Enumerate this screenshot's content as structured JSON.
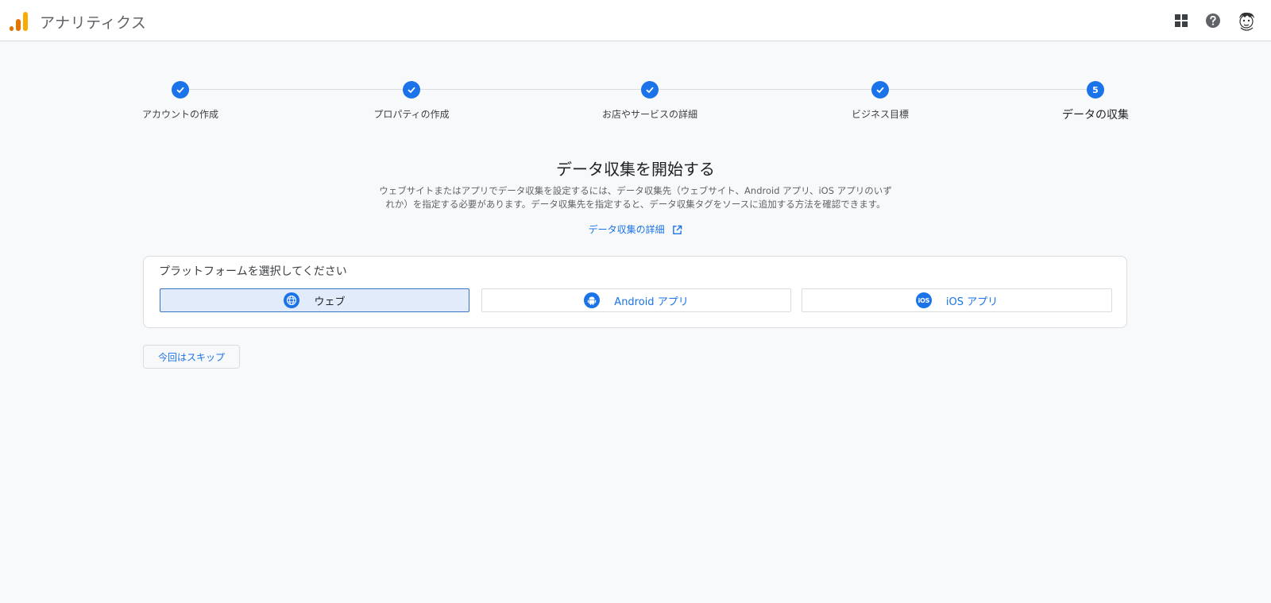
{
  "header": {
    "app_title": "アナリティクス",
    "brand_colors": [
      "#e37400",
      "#f9ab00"
    ],
    "icons": [
      "apps-grid-icon",
      "help-icon",
      "avatar"
    ]
  },
  "stepper": {
    "steps": [
      {
        "label": "アカウントの作成",
        "status": "done"
      },
      {
        "label": "プロパティの作成",
        "status": "done"
      },
      {
        "label": "お店やサービスの詳細",
        "status": "done"
      },
      {
        "label": "ビジネス目標",
        "status": "done"
      },
      {
        "label": "データの収集",
        "status": "current",
        "number": "5"
      }
    ]
  },
  "main": {
    "title": "データ収集を開始する",
    "description_line1": "ウェブサイトまたはアプリでデータ収集を設定するには、データ収集先（ウェブサイト、Android アプリ、iOS アプリのいず",
    "description_line2": "れか）を指定する必要があります。データ収集先を指定すると、データ収集タグをソースに追加する方法を確認できます。",
    "learn_more": "データ収集の詳細"
  },
  "platform": {
    "title": "プラットフォームを選択してください",
    "options": [
      {
        "label": "ウェブ",
        "icon": "globe-icon",
        "selected": true
      },
      {
        "label": "Android アプリ",
        "icon": "android-icon",
        "selected": false
      },
      {
        "label": "iOS アプリ",
        "icon": "ios-icon",
        "icon_text": "iOS",
        "selected": false
      }
    ]
  },
  "skip_button": "今回はスキップ",
  "colors": {
    "accent": "#1a73e8",
    "selected_bg": "#e1ebf9",
    "background": "#f8f9fa"
  }
}
